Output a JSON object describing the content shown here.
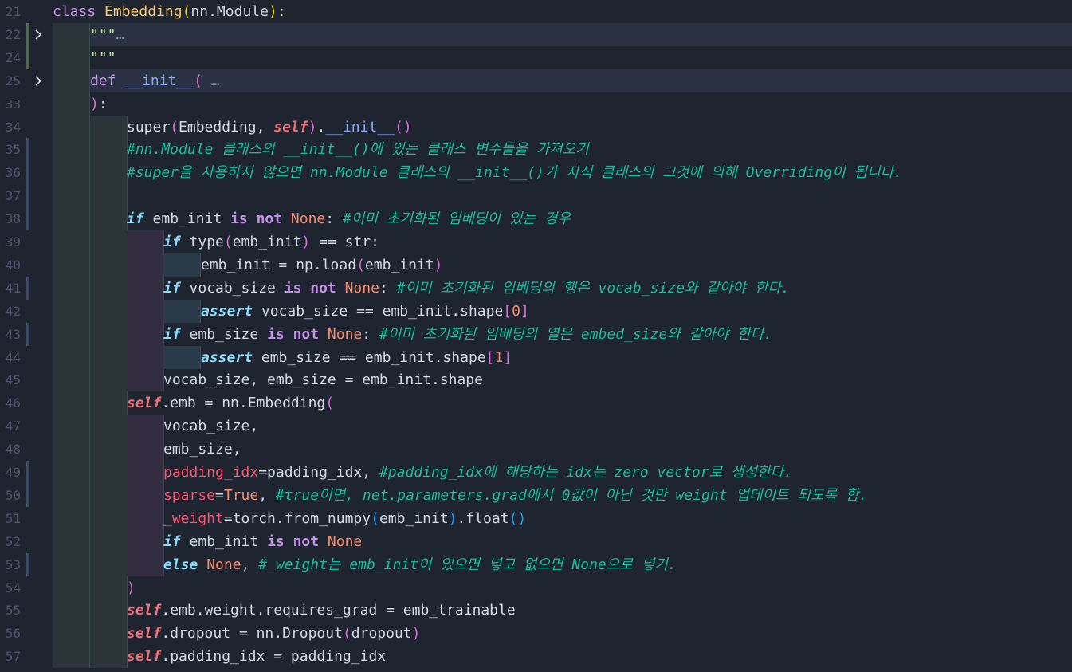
{
  "editor": {
    "lines": [
      {
        "n": "21",
        "tokens": [
          [
            "kw",
            "class "
          ],
          [
            "cls",
            "Embedding"
          ],
          [
            "paren1",
            "("
          ],
          [
            "plain",
            "nn.Module"
          ],
          [
            "paren1",
            ")"
          ],
          [
            "plain",
            ":"
          ]
        ]
      },
      {
        "n": "22",
        "tokens": [
          [
            "str",
            "\"\"\""
          ],
          [
            "ell",
            "…"
          ]
        ]
      },
      {
        "n": "24",
        "tokens": [
          [
            "str",
            "\"\"\""
          ]
        ]
      },
      {
        "n": "25",
        "tokens": [
          [
            "kw",
            "def "
          ],
          [
            "fn",
            "__init__"
          ],
          [
            "paren2",
            "( "
          ],
          [
            "ell",
            "…"
          ]
        ]
      },
      {
        "n": "33",
        "tokens": [
          [
            "paren2",
            ")"
          ],
          [
            "plain",
            ":"
          ]
        ]
      },
      {
        "n": "34",
        "tokens": [
          [
            "plain",
            "super"
          ],
          [
            "paren2",
            "("
          ],
          [
            "plain",
            "Embedding, "
          ],
          [
            "self",
            "self"
          ],
          [
            "paren2",
            ")"
          ],
          [
            "plain",
            "."
          ],
          [
            "fn",
            "__init__"
          ],
          [
            "paren2",
            "()"
          ]
        ]
      },
      {
        "n": "35",
        "tokens": [
          [
            "cm",
            "#nn.Module 클래스의 __init__()에 있는 클래스 변수들을 가져오기"
          ]
        ]
      },
      {
        "n": "36",
        "tokens": [
          [
            "cm",
            "#super을 사용하지 않으면 nn.Module 클래스의 __init__()가 자식 클래스의 그것에 의해 Overriding이 됩니다."
          ]
        ]
      },
      {
        "n": "37",
        "tokens": []
      },
      {
        "n": "38",
        "tokens": [
          [
            "ctrl",
            "if "
          ],
          [
            "plain",
            "emb_init "
          ],
          [
            "op",
            "is not "
          ],
          [
            "const",
            "None"
          ],
          [
            "plain",
            ": "
          ],
          [
            "cm",
            "#이미 초기화된 임베딩이 있는 경우"
          ]
        ]
      },
      {
        "n": "39",
        "tokens": [
          [
            "ctrl",
            "if "
          ],
          [
            "plain",
            "type"
          ],
          [
            "paren2",
            "("
          ],
          [
            "plain",
            "emb_init"
          ],
          [
            "paren2",
            ")"
          ],
          [
            "plain",
            " == str:"
          ]
        ]
      },
      {
        "n": "40",
        "tokens": [
          [
            "plain",
            "emb_init = np.load"
          ],
          [
            "paren2",
            "("
          ],
          [
            "plain",
            "emb_init"
          ],
          [
            "paren2",
            ")"
          ]
        ]
      },
      {
        "n": "41",
        "tokens": [
          [
            "ctrl",
            "if "
          ],
          [
            "plain",
            "vocab_size "
          ],
          [
            "op",
            "is not "
          ],
          [
            "const",
            "None"
          ],
          [
            "plain",
            ": "
          ],
          [
            "cm",
            "#이미 초기화된 임베딩의 행은 vocab_size와 같아야 한다."
          ]
        ]
      },
      {
        "n": "42",
        "tokens": [
          [
            "ctrl",
            "assert "
          ],
          [
            "plain",
            "vocab_size == emb_init.shape"
          ],
          [
            "paren2",
            "["
          ],
          [
            "num",
            "0"
          ],
          [
            "paren2",
            "]"
          ]
        ]
      },
      {
        "n": "43",
        "tokens": [
          [
            "ctrl",
            "if "
          ],
          [
            "plain",
            "emb_size "
          ],
          [
            "op",
            "is not "
          ],
          [
            "const",
            "None"
          ],
          [
            "plain",
            ": "
          ],
          [
            "cm",
            "#이미 초기화된 임베딩의 열은 embed_size와 같아야 한다."
          ]
        ]
      },
      {
        "n": "44",
        "tokens": [
          [
            "ctrl",
            "assert "
          ],
          [
            "plain",
            "emb_size == emb_init.shape"
          ],
          [
            "paren2",
            "["
          ],
          [
            "num",
            "1"
          ],
          [
            "paren2",
            "]"
          ]
        ]
      },
      {
        "n": "45",
        "tokens": [
          [
            "plain",
            "vocab_size, emb_size = emb_init.shape"
          ]
        ]
      },
      {
        "n": "46",
        "tokens": [
          [
            "self",
            "self"
          ],
          [
            "plain",
            ".emb = nn.Embedding"
          ],
          [
            "paren2",
            "("
          ]
        ]
      },
      {
        "n": "47",
        "tokens": [
          [
            "plain",
            "vocab_size,"
          ]
        ]
      },
      {
        "n": "48",
        "tokens": [
          [
            "plain",
            "emb_size,"
          ]
        ]
      },
      {
        "n": "49",
        "tokens": [
          [
            "param",
            "padding_idx"
          ],
          [
            "plain",
            "=padding_idx, "
          ],
          [
            "cm",
            "#padding_idx에 해당하는 idx는 zero vector로 생성한다."
          ]
        ]
      },
      {
        "n": "50",
        "tokens": [
          [
            "param",
            "sparse"
          ],
          [
            "plain",
            "="
          ],
          [
            "const",
            "True"
          ],
          [
            "plain",
            ", "
          ],
          [
            "cm",
            "#true이면, net.parameters.grad에서 0값이 아닌 것만 weight 업데이트 되도록 함."
          ]
        ]
      },
      {
        "n": "51",
        "tokens": [
          [
            "param",
            "_weight"
          ],
          [
            "plain",
            "=torch.from_numpy"
          ],
          [
            "paren3",
            "("
          ],
          [
            "plain",
            "emb_init"
          ],
          [
            "paren3",
            ")"
          ],
          [
            "plain",
            ".float"
          ],
          [
            "paren3",
            "()"
          ]
        ]
      },
      {
        "n": "52",
        "tokens": [
          [
            "ctrl",
            "if "
          ],
          [
            "plain",
            "emb_init "
          ],
          [
            "op",
            "is not "
          ],
          [
            "const",
            "None"
          ]
        ]
      },
      {
        "n": "53",
        "tokens": [
          [
            "ctrl",
            "else "
          ],
          [
            "const",
            "None"
          ],
          [
            "plain",
            ", "
          ],
          [
            "cm",
            "#_weight는 emb_init이 있으면 넣고 없으면 None으로 넣기."
          ]
        ]
      },
      {
        "n": "54",
        "tokens": [
          [
            "paren2",
            ")"
          ]
        ]
      },
      {
        "n": "55",
        "tokens": [
          [
            "self",
            "self"
          ],
          [
            "plain",
            ".emb.weight.requires_grad = emb_trainable"
          ]
        ]
      },
      {
        "n": "56",
        "tokens": [
          [
            "self",
            "self"
          ],
          [
            "plain",
            ".dropout = nn.Dropout"
          ],
          [
            "paren2",
            "("
          ],
          [
            "plain",
            "dropout"
          ],
          [
            "paren2",
            ")"
          ]
        ]
      },
      {
        "n": "57",
        "tokens": [
          [
            "self",
            "self"
          ],
          [
            "plain",
            ".padding_idx = padding_idx"
          ]
        ]
      }
    ]
  },
  "folds": {
    "fold_22": "collapsed",
    "fold_25": "collapsed"
  },
  "colors": {
    "background": "#1e2430",
    "keyword": "#c792ea",
    "control": "#89ddff",
    "class_name": "#ffcb6b",
    "self": "#f07178",
    "constant": "#f78c6c",
    "comment": "#1abc9c",
    "parameter": "#ff5370"
  },
  "icons": {
    "fold": "chevron-right-icon"
  }
}
